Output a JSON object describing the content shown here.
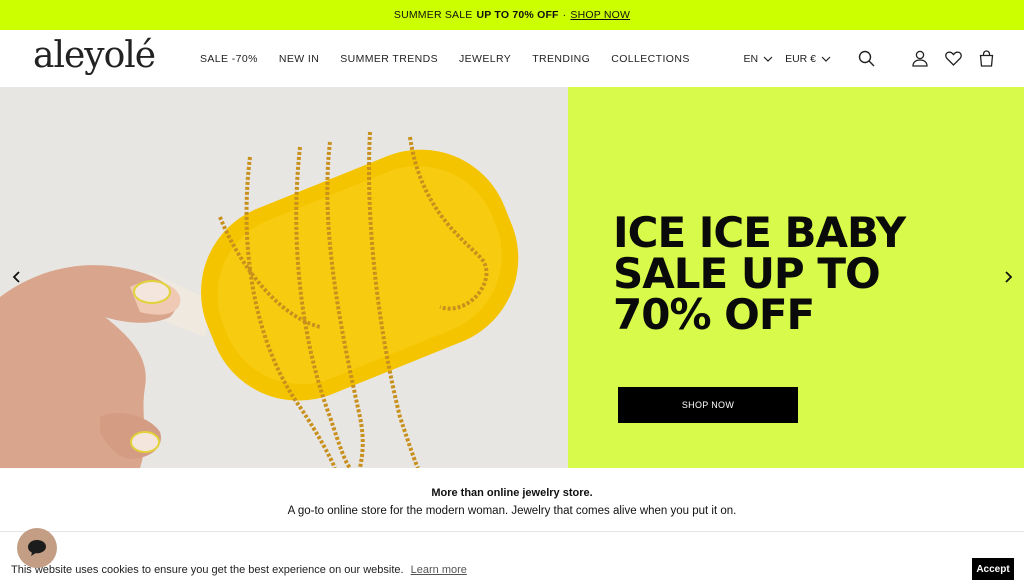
{
  "promo": {
    "prefix": "SUMMER SALE",
    "highlight": "UP TO 70% OFF",
    "separator": "·",
    "link": "SHOP NOW"
  },
  "header": {
    "logo": "aleyolé",
    "nav": [
      "SALE -70%",
      "NEW IN",
      "SUMMER TRENDS",
      "JEWELRY",
      "TRENDING",
      "COLLECTIONS"
    ],
    "language": "EN",
    "currency": "EUR €",
    "icons": [
      "search-icon",
      "account-icon",
      "wishlist-icon",
      "cart-icon"
    ]
  },
  "hero": {
    "title": "ICE ICE BABY\nSALE UP TO\n70% OFF",
    "button": "SHOP NOW",
    "panel_color": "#d8fa4a"
  },
  "intro": {
    "title": "More than online jewelry store.",
    "text": "A go-to online store for the modern woman. Jewelry that comes alive when you put it on."
  },
  "cookie": {
    "text": "This website uses cookies to ensure you get the best experience on our website.",
    "link": "Learn more",
    "accept": "Accept"
  },
  "colors": {
    "accent": "#ccff00",
    "chat_bubble": "#c49e84"
  }
}
